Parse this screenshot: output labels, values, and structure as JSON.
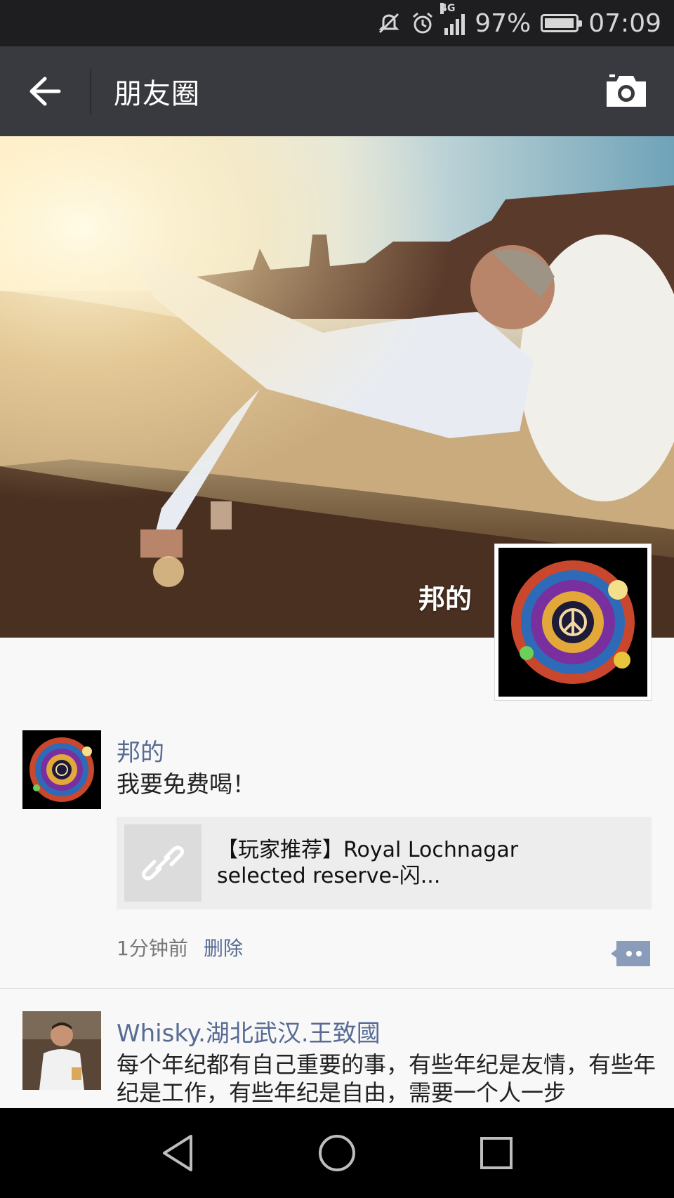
{
  "status_bar": {
    "battery_percent": "97%",
    "battery_level": 0.97,
    "network_type": "4G",
    "time": "07:09",
    "icons": [
      "mute-icon",
      "alarm-icon",
      "signal-icon",
      "battery-icon"
    ]
  },
  "header": {
    "title": "朋友圈",
    "back_icon": "arrow-left-icon",
    "camera_icon": "camera-icon"
  },
  "cover": {
    "user_name": "邦的"
  },
  "posts": [
    {
      "author": "邦的",
      "text": "我要免费喝！",
      "link": {
        "title": "【玩家推荐】Royal Lochnagar selected reserve-闪...",
        "icon": "link-icon"
      },
      "time": "1分钟前",
      "delete_label": "删除",
      "comment_icon": "comment-icon"
    },
    {
      "author": "Whisky.湖北武汉.王致國",
      "text": "每个年纪都有自己重要的事，有些年纪是友情，有些年纪是工作，有些年纪是自由，需要一个人一步"
    }
  ],
  "nav": {
    "icons": [
      "back-triangle-icon",
      "home-circle-icon",
      "recents-square-icon"
    ]
  },
  "colors": {
    "status_bar_bg": "#1e1d20",
    "title_bar_bg": "#393a3f",
    "name_link": "#576b95",
    "feed_bg": "#f8f8f8"
  }
}
